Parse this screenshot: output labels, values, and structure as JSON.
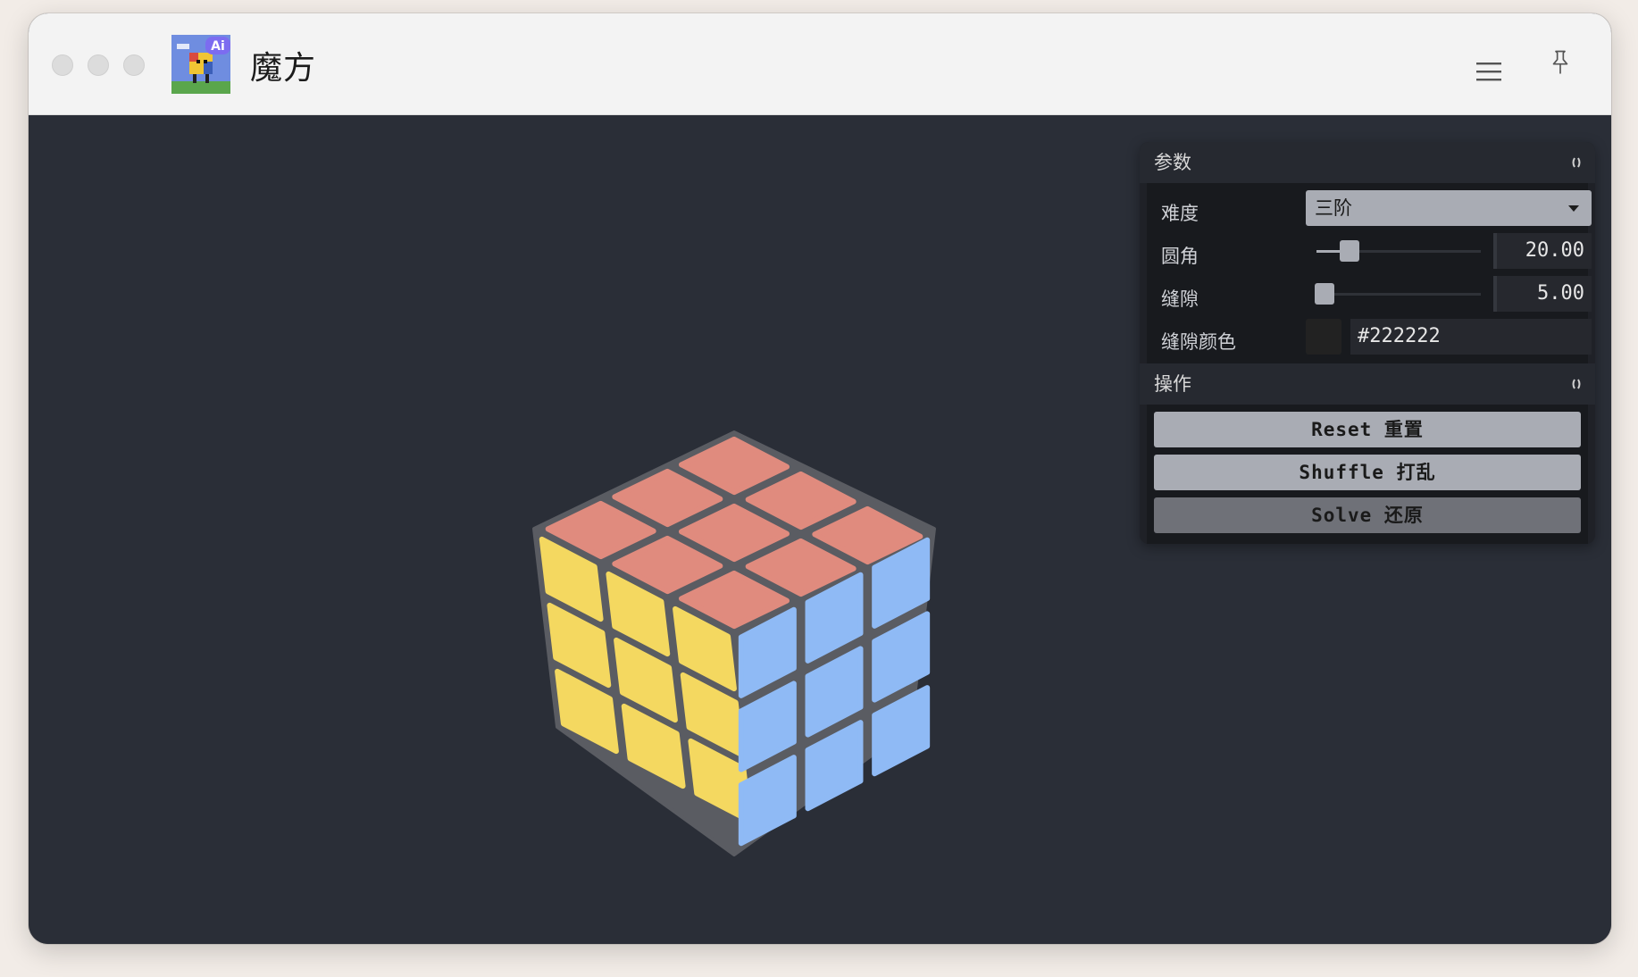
{
  "window": {
    "title": "魔方",
    "icon_badge": "Ai"
  },
  "icons": {
    "menu": "hamburger-menu-icon",
    "pin": "pin-icon"
  },
  "panel": {
    "params": {
      "heading": "参数",
      "difficulty": {
        "label": "难度",
        "value": "三阶"
      },
      "radius": {
        "label": "圆角",
        "value": "20.00",
        "fraction": 0.2
      },
      "gap": {
        "label": "缝隙",
        "value": "5.00",
        "fraction": 0.05
      },
      "gap_color": {
        "label": "缝隙颜色",
        "value": "#222222"
      }
    },
    "actions": {
      "heading": "操作",
      "reset": "Reset 重置",
      "shuffle": "Shuffle 打乱",
      "solve": "Solve 还原"
    }
  },
  "cube": {
    "size": 3,
    "colors": {
      "top": "#e08b7e",
      "left": "#f4d860",
      "right": "#8fbaf5",
      "gap": "#5a5c62"
    }
  }
}
